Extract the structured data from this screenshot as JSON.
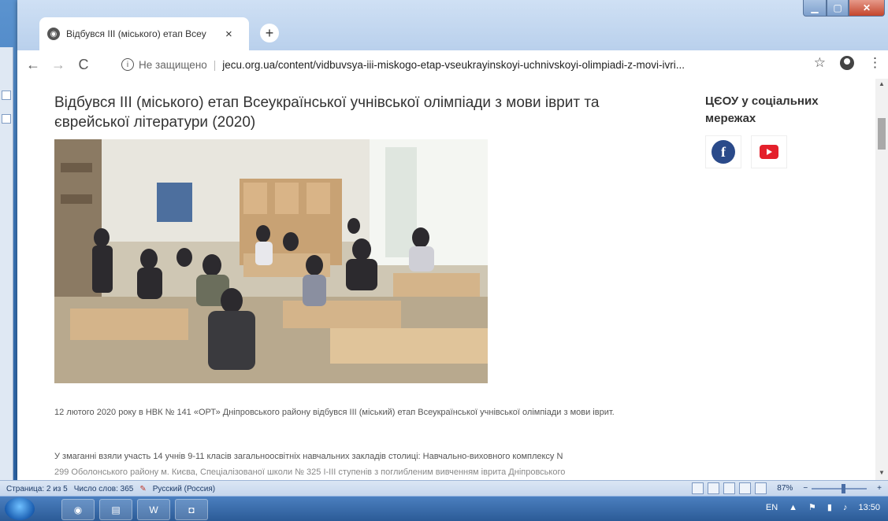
{
  "browser": {
    "tab_title": "Відбувся ІІІ (міського) етап Всеу",
    "tab_close": "×",
    "new_tab": "+",
    "nav_back": "←",
    "nav_forward": "→",
    "nav_reload": "C",
    "not_secure": "Не защищено",
    "url": "jecu.org.ua/content/vidbuvsya-iii-miskogo-etap-vseukrayinskoyi-uchnivskoyi-olimpiadi-z-movi-ivri...",
    "bookmark": "☆",
    "menu": "⋮"
  },
  "article": {
    "title": "Відбувся ІІІ (міського) етап Всеукраїнської учнівської олімпіади з мови іврит та єврейської літератури (2020)",
    "paragraph1": "12 лютого 2020 року в НВК № 141 «ОРТ» Дніпровського району відбувся ІІІ (міський) етап Всеукраїнської учнівської олімпіади з мови іврит.",
    "paragraph2": "У змаганні взяли участь 14 учнів 9-11 класів загальноосвітніх навчальних закладів столиці: Навчально-виховного комплексу N",
    "paragraph2_cut": "299 Оболонського району м. Києва, Спеціалізованої школи № 325 І-ІІІ ступенів з поглибленим вивченням іврита Дніпровського"
  },
  "sidebar": {
    "title": "ЦЄОУ у соціальних мережах",
    "facebook_glyph": "f"
  },
  "word_status": {
    "page": "Страница: 2 из 5",
    "words": "Число слов: 365",
    "language": "Русский (Россия)",
    "zoom": "87%",
    "zoom_minus": "−",
    "zoom_plus": "+"
  },
  "taskbar": {
    "lang": "EN",
    "time": "13:50"
  },
  "colors": {
    "facebook": "#2a4a8a",
    "youtube": "#e4202b"
  }
}
